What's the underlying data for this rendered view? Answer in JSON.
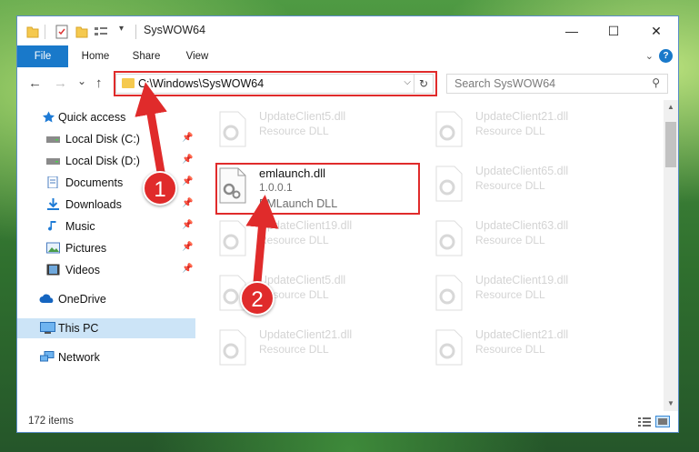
{
  "window": {
    "title": "SysWOW64",
    "minimize": "—",
    "maximize": "☐",
    "close": "✕"
  },
  "ribbon": {
    "tabs": [
      "File",
      "Home",
      "Share",
      "View"
    ],
    "help": "?"
  },
  "nav": {
    "back": "←",
    "forward": "→",
    "recent": "⌄",
    "up": "↑",
    "address": "C:\\Windows\\SysWOW64",
    "search_placeholder": "Search SysWOW64"
  },
  "sidebar": {
    "items": [
      {
        "label": "Quick access",
        "icon": "star-icon",
        "pinned": false
      },
      {
        "label": "Local Disk (C:)",
        "icon": "drive-icon",
        "pinned": true
      },
      {
        "label": "Local Disk (D:)",
        "icon": "drive-icon",
        "pinned": true
      },
      {
        "label": "Documents",
        "icon": "documents-icon",
        "pinned": true
      },
      {
        "label": "Downloads",
        "icon": "downloads-icon",
        "pinned": true
      },
      {
        "label": "Music",
        "icon": "music-icon",
        "pinned": true
      },
      {
        "label": "Pictures",
        "icon": "pictures-icon",
        "pinned": true
      },
      {
        "label": "Videos",
        "icon": "videos-icon",
        "pinned": true
      },
      {
        "label": "OneDrive",
        "icon": "onedrive-icon",
        "pinned": false
      },
      {
        "label": "This PC",
        "icon": "computer-icon",
        "pinned": false,
        "selected": true
      },
      {
        "label": "Network",
        "icon": "network-icon",
        "pinned": false
      }
    ]
  },
  "files": {
    "highlighted": {
      "name": "emlaunch.dll",
      "version": "1.0.0.1",
      "description": "EMLaunch DLL"
    },
    "faded": [
      {
        "name": "UpdateClient5.dll",
        "desc": "Resource DLL"
      },
      {
        "name": "UpdateClient21.dll",
        "desc": "Resource DLL"
      },
      {
        "name": "UpdateClient65.dll",
        "desc": "Resource DLL"
      },
      {
        "name": "UpdateClient19.dll",
        "desc": "Resource DLL"
      },
      {
        "name": "UpdateClient63.dll",
        "desc": "Resource DLL"
      },
      {
        "name": "UpdateClient5.dll",
        "desc": "Resource DLL"
      },
      {
        "name": "UpdateClient19.dll",
        "desc": "Resource DLL"
      },
      {
        "name": "UpdateClient21.dll",
        "desc": "Resource DLL"
      },
      {
        "name": "UpdateClient21.dll",
        "desc": "Resource DLL"
      }
    ]
  },
  "status": {
    "item_count": "172 items"
  },
  "annotations": {
    "step1": "1",
    "step2": "2",
    "color": "#e02b2b"
  }
}
